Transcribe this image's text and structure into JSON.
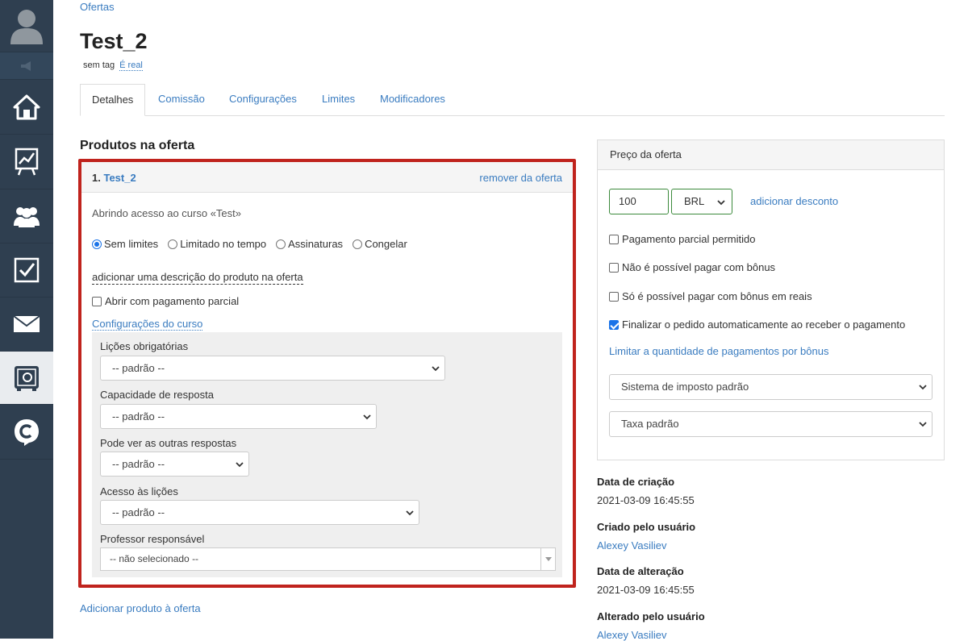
{
  "breadcrumb": "Ofertas",
  "title": "Test_2",
  "tag_label": "sem tag",
  "tag_link": "É real",
  "tabs": [
    "Detalhes",
    "Comissão",
    "Configurações",
    "Limites",
    "Modificadores"
  ],
  "products_section_title": "Produtos na oferta",
  "product": {
    "number": "1.",
    "name": "Test_2",
    "remove_label": "remover da oferta",
    "description": "Abrindo acesso ao curso «Test»",
    "radio_options": [
      "Sem limites",
      "Limitado no tempo",
      "Assinaturas",
      "Congelar"
    ],
    "selected_radio": "Sem limites",
    "add_description_label": "adicionar uma descrição do produto na oferta",
    "partial_payment_label": "Abrir com pagamento parcial",
    "partial_payment_checked": false,
    "course_settings_label": "Configurações do curso",
    "settings": [
      {
        "label": "Lições obrigatórias",
        "value": "-- padrão --"
      },
      {
        "label": "Capacidade de resposta",
        "value": "-- padrão --"
      },
      {
        "label": "Pode ver as outras respostas",
        "value": "-- padrão --"
      },
      {
        "label": "Acesso às lições",
        "value": "-- padrão --"
      },
      {
        "label": "Professor responsável",
        "value": "-- não selecionado --"
      }
    ]
  },
  "add_product_label": "Adicionar produto à oferta",
  "price": {
    "header": "Preço da oferta",
    "amount": "100",
    "currency": "BRL",
    "add_discount_label": "adicionar desconto",
    "checkboxes": [
      {
        "label": "Pagamento parcial permitido",
        "checked": false
      },
      {
        "label": "Não é possível pagar com bônus",
        "checked": false
      },
      {
        "label": "Só é possível pagar com bônus em reais",
        "checked": false
      },
      {
        "label": "Finalizar o pedido automaticamente ao receber o pagamento",
        "checked": true
      }
    ],
    "limit_bonus_link": "Limitar a quantidade de pagamentos por bônus",
    "tax_system": "Sistema de imposto padrão",
    "tax_rate": "Taxa padrão"
  },
  "meta": {
    "created_date_label": "Data de criação",
    "created_date": "2021-03-09 16:45:55",
    "created_by_label": "Criado pelo usuário",
    "created_by": "Alexey Vasiliev",
    "modified_date_label": "Data de alteração",
    "modified_date": "2021-03-09 16:45:55",
    "modified_by_label": "Alterado pelo usuário",
    "modified_by": "Alexey Vasiliev"
  },
  "sidebar_icons": [
    "user-avatar-icon",
    "megaphone-icon",
    "home-icon",
    "chart-icon",
    "users-icon",
    "tasks-icon",
    "mail-icon",
    "safe-icon",
    "chat-icon"
  ],
  "colors": {
    "sidebar": "#2f3f50",
    "link": "#3a7cc0",
    "highlight_border": "#c0231d",
    "input_border": "#3c8a3c"
  }
}
